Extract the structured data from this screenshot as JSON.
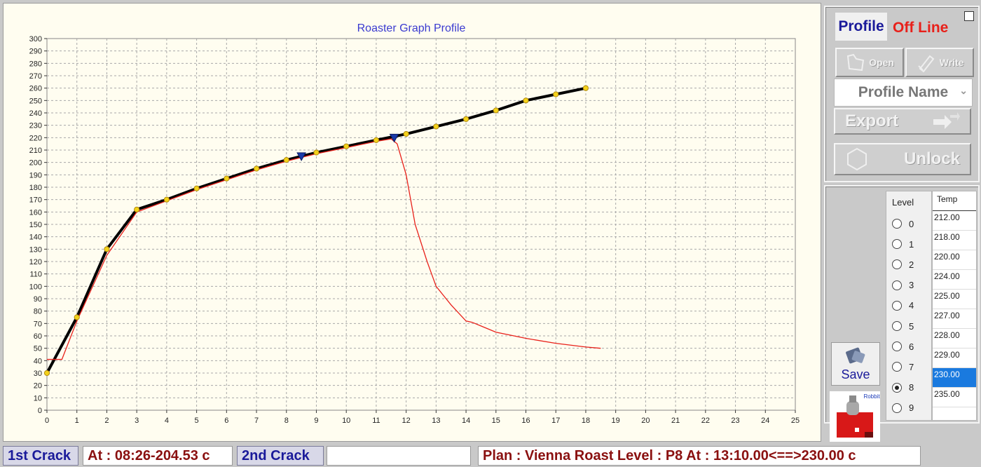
{
  "chart_data": {
    "type": "line",
    "title": "Roaster Graph Profile",
    "xlabel": "",
    "ylabel": "",
    "xlim": [
      0,
      25
    ],
    "ylim": [
      0,
      300
    ],
    "x_ticks": [
      "0",
      "1",
      "2",
      "3",
      "4",
      "5",
      "6",
      "7",
      "8",
      "9",
      "10",
      "11",
      "12",
      "13",
      "14",
      "15",
      "16",
      "17",
      "18",
      "19",
      "20",
      "21",
      "22",
      "23",
      "24",
      "25"
    ],
    "y_ticks": [
      "0",
      "10",
      "20",
      "30",
      "40",
      "50",
      "60",
      "70",
      "80",
      "90",
      "100",
      "110",
      "120",
      "130",
      "140",
      "150",
      "160",
      "170",
      "180",
      "190",
      "200",
      "210",
      "220",
      "230",
      "240",
      "250",
      "260",
      "270",
      "280",
      "290",
      "300"
    ],
    "grid": true,
    "series": [
      {
        "type": "profile",
        "color": "#000000",
        "x": [
          0,
          1,
          2,
          3,
          4,
          5,
          6,
          7,
          8,
          9,
          10,
          11,
          12,
          13,
          14,
          15,
          16,
          17,
          18
        ],
        "y": [
          30,
          75,
          130,
          162,
          170,
          179,
          187,
          195,
          202,
          208,
          213,
          218,
          223,
          229,
          235,
          242,
          250,
          255,
          260
        ]
      },
      {
        "type": "actual",
        "color": "#e8201a",
        "x": [
          0,
          0.5,
          1,
          2,
          3,
          4,
          5,
          6,
          7,
          8,
          9,
          10,
          11,
          11.5,
          11.7,
          12,
          12.3,
          12.7,
          13,
          13.5,
          14,
          14.2,
          14.5,
          15,
          16,
          17,
          18,
          18.5
        ],
        "y": [
          41,
          41,
          72,
          125,
          160,
          169,
          178,
          186,
          194,
          201,
          207,
          212,
          217,
          219,
          215,
          190,
          150,
          120,
          100,
          85,
          72,
          71,
          68,
          63,
          58,
          54,
          51,
          50
        ]
      },
      {
        "type": "markers",
        "color": "#1a3aa8",
        "x": [
          8.5,
          11.6
        ],
        "y": [
          205,
          220
        ]
      }
    ]
  },
  "side": {
    "profile_label": "Profile",
    "status": "Off Line",
    "open_label": "Open",
    "write_label": "Write",
    "profile_name": "Profile Name",
    "export_label": "Export",
    "unlock_label": "Unlock"
  },
  "levels": {
    "title": "Level",
    "temp_header": "Temp",
    "items": [
      {
        "level": "0",
        "temp": "212.00",
        "selected": false
      },
      {
        "level": "1",
        "temp": "218.00",
        "selected": false
      },
      {
        "level": "2",
        "temp": "220.00",
        "selected": false
      },
      {
        "level": "3",
        "temp": "224.00",
        "selected": false
      },
      {
        "level": "4",
        "temp": "225.00",
        "selected": false
      },
      {
        "level": "5",
        "temp": "227.00",
        "selected": false
      },
      {
        "level": "6",
        "temp": "228.00",
        "selected": false
      },
      {
        "level": "7",
        "temp": "229.00",
        "selected": false
      },
      {
        "level": "8",
        "temp": "230.00",
        "selected": true
      },
      {
        "level": "9",
        "temp": "235.00",
        "selected": false
      }
    ],
    "save_label": "Save",
    "logo_text": "Robbit"
  },
  "bottom": {
    "first_crack_label": "1st Crack",
    "first_crack_value": "At : 08:26-204.53 c",
    "second_crack_label": "2nd Crack",
    "second_crack_value": "",
    "plan": "Plan : Vienna Roast Level : P8 At : 13:10.00<==>230.00 c"
  }
}
